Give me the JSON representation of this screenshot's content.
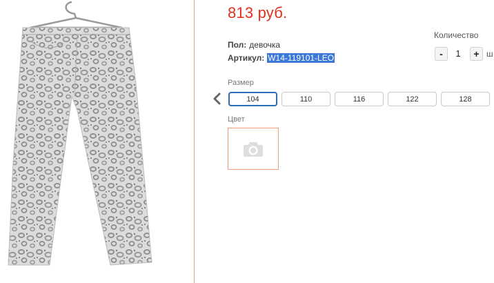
{
  "product": {
    "price": "813 руб.",
    "gender_label": "Пол:",
    "gender_value": "девочка",
    "sku_label": "Артикул:",
    "sku_value": "W14-119101-LEO"
  },
  "quantity": {
    "title": "Количество",
    "minus_label": "-",
    "value": "1",
    "plus_label": "+",
    "unit": "ш"
  },
  "size": {
    "label": "Размер",
    "options": [
      "104",
      "110",
      "116",
      "122",
      "128"
    ],
    "selected": "104"
  },
  "color": {
    "label": "Цвет",
    "swatch_icon": "camera-icon"
  },
  "colors": {
    "price": "#e0301e",
    "accent_border": "#f0a070",
    "selected_size_border": "#2a6fb5",
    "highlight": "#3b78d8"
  },
  "icons": {
    "prev": "chevron-left-icon",
    "placeholder": "camera-icon"
  }
}
